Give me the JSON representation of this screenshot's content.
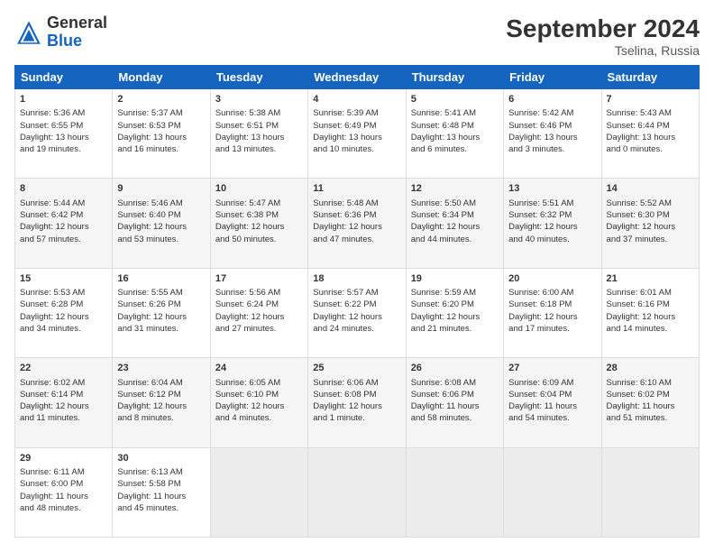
{
  "header": {
    "logo_general": "General",
    "logo_blue": "Blue",
    "month_title": "September 2024",
    "location": "Tselina, Russia"
  },
  "weekdays": [
    "Sunday",
    "Monday",
    "Tuesday",
    "Wednesday",
    "Thursday",
    "Friday",
    "Saturday"
  ],
  "weeks": [
    [
      {
        "day": "1",
        "lines": [
          "Sunrise: 5:36 AM",
          "Sunset: 6:55 PM",
          "Daylight: 13 hours",
          "and 19 minutes."
        ]
      },
      {
        "day": "2",
        "lines": [
          "Sunrise: 5:37 AM",
          "Sunset: 6:53 PM",
          "Daylight: 13 hours",
          "and 16 minutes."
        ]
      },
      {
        "day": "3",
        "lines": [
          "Sunrise: 5:38 AM",
          "Sunset: 6:51 PM",
          "Daylight: 13 hours",
          "and 13 minutes."
        ]
      },
      {
        "day": "4",
        "lines": [
          "Sunrise: 5:39 AM",
          "Sunset: 6:49 PM",
          "Daylight: 13 hours",
          "and 10 minutes."
        ]
      },
      {
        "day": "5",
        "lines": [
          "Sunrise: 5:41 AM",
          "Sunset: 6:48 PM",
          "Daylight: 13 hours",
          "and 6 minutes."
        ]
      },
      {
        "day": "6",
        "lines": [
          "Sunrise: 5:42 AM",
          "Sunset: 6:46 PM",
          "Daylight: 13 hours",
          "and 3 minutes."
        ]
      },
      {
        "day": "7",
        "lines": [
          "Sunrise: 5:43 AM",
          "Sunset: 6:44 PM",
          "Daylight: 13 hours",
          "and 0 minutes."
        ]
      }
    ],
    [
      {
        "day": "8",
        "lines": [
          "Sunrise: 5:44 AM",
          "Sunset: 6:42 PM",
          "Daylight: 12 hours",
          "and 57 minutes."
        ]
      },
      {
        "day": "9",
        "lines": [
          "Sunrise: 5:46 AM",
          "Sunset: 6:40 PM",
          "Daylight: 12 hours",
          "and 53 minutes."
        ]
      },
      {
        "day": "10",
        "lines": [
          "Sunrise: 5:47 AM",
          "Sunset: 6:38 PM",
          "Daylight: 12 hours",
          "and 50 minutes."
        ]
      },
      {
        "day": "11",
        "lines": [
          "Sunrise: 5:48 AM",
          "Sunset: 6:36 PM",
          "Daylight: 12 hours",
          "and 47 minutes."
        ]
      },
      {
        "day": "12",
        "lines": [
          "Sunrise: 5:50 AM",
          "Sunset: 6:34 PM",
          "Daylight: 12 hours",
          "and 44 minutes."
        ]
      },
      {
        "day": "13",
        "lines": [
          "Sunrise: 5:51 AM",
          "Sunset: 6:32 PM",
          "Daylight: 12 hours",
          "and 40 minutes."
        ]
      },
      {
        "day": "14",
        "lines": [
          "Sunrise: 5:52 AM",
          "Sunset: 6:30 PM",
          "Daylight: 12 hours",
          "and 37 minutes."
        ]
      }
    ],
    [
      {
        "day": "15",
        "lines": [
          "Sunrise: 5:53 AM",
          "Sunset: 6:28 PM",
          "Daylight: 12 hours",
          "and 34 minutes."
        ]
      },
      {
        "day": "16",
        "lines": [
          "Sunrise: 5:55 AM",
          "Sunset: 6:26 PM",
          "Daylight: 12 hours",
          "and 31 minutes."
        ]
      },
      {
        "day": "17",
        "lines": [
          "Sunrise: 5:56 AM",
          "Sunset: 6:24 PM",
          "Daylight: 12 hours",
          "and 27 minutes."
        ]
      },
      {
        "day": "18",
        "lines": [
          "Sunrise: 5:57 AM",
          "Sunset: 6:22 PM",
          "Daylight: 12 hours",
          "and 24 minutes."
        ]
      },
      {
        "day": "19",
        "lines": [
          "Sunrise: 5:59 AM",
          "Sunset: 6:20 PM",
          "Daylight: 12 hours",
          "and 21 minutes."
        ]
      },
      {
        "day": "20",
        "lines": [
          "Sunrise: 6:00 AM",
          "Sunset: 6:18 PM",
          "Daylight: 12 hours",
          "and 17 minutes."
        ]
      },
      {
        "day": "21",
        "lines": [
          "Sunrise: 6:01 AM",
          "Sunset: 6:16 PM",
          "Daylight: 12 hours",
          "and 14 minutes."
        ]
      }
    ],
    [
      {
        "day": "22",
        "lines": [
          "Sunrise: 6:02 AM",
          "Sunset: 6:14 PM",
          "Daylight: 12 hours",
          "and 11 minutes."
        ]
      },
      {
        "day": "23",
        "lines": [
          "Sunrise: 6:04 AM",
          "Sunset: 6:12 PM",
          "Daylight: 12 hours",
          "and 8 minutes."
        ]
      },
      {
        "day": "24",
        "lines": [
          "Sunrise: 6:05 AM",
          "Sunset: 6:10 PM",
          "Daylight: 12 hours",
          "and 4 minutes."
        ]
      },
      {
        "day": "25",
        "lines": [
          "Sunrise: 6:06 AM",
          "Sunset: 6:08 PM",
          "Daylight: 12 hours",
          "and 1 minute."
        ]
      },
      {
        "day": "26",
        "lines": [
          "Sunrise: 6:08 AM",
          "Sunset: 6:06 PM",
          "Daylight: 11 hours",
          "and 58 minutes."
        ]
      },
      {
        "day": "27",
        "lines": [
          "Sunrise: 6:09 AM",
          "Sunset: 6:04 PM",
          "Daylight: 11 hours",
          "and 54 minutes."
        ]
      },
      {
        "day": "28",
        "lines": [
          "Sunrise: 6:10 AM",
          "Sunset: 6:02 PM",
          "Daylight: 11 hours",
          "and 51 minutes."
        ]
      }
    ],
    [
      {
        "day": "29",
        "lines": [
          "Sunrise: 6:11 AM",
          "Sunset: 6:00 PM",
          "Daylight: 11 hours",
          "and 48 minutes."
        ]
      },
      {
        "day": "30",
        "lines": [
          "Sunrise: 6:13 AM",
          "Sunset: 5:58 PM",
          "Daylight: 11 hours",
          "and 45 minutes."
        ]
      },
      {
        "day": "",
        "lines": []
      },
      {
        "day": "",
        "lines": []
      },
      {
        "day": "",
        "lines": []
      },
      {
        "day": "",
        "lines": []
      },
      {
        "day": "",
        "lines": []
      }
    ]
  ]
}
